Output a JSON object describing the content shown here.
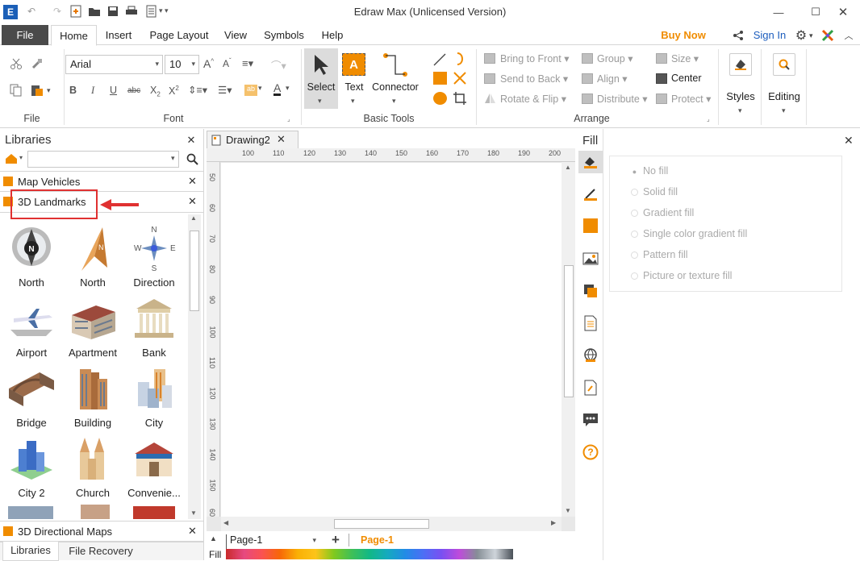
{
  "window": {
    "title": "Edraw Max (Unlicensed Version)"
  },
  "menu": {
    "tabs": [
      "File",
      "Home",
      "Insert",
      "Page Layout",
      "View",
      "Symbols",
      "Help"
    ],
    "buy_now": "Buy Now",
    "sign_in": "Sign In"
  },
  "ribbon": {
    "file_group": "File",
    "font": {
      "name": "Arial",
      "size": "10",
      "group": "Font"
    },
    "basic_tools": {
      "select": "Select",
      "text": "Text",
      "connector": "Connector",
      "group": "Basic Tools"
    },
    "arrange": {
      "bring_to_front": "Bring to Front",
      "send_to_back": "Send to Back",
      "rotate_flip": "Rotate & Flip",
      "group": "Group",
      "align": "Align",
      "distribute": "Distribute",
      "size": "Size",
      "center": "Center",
      "protect": "Protect",
      "group_label": "Arrange"
    },
    "styles": "Styles",
    "editing": "Editing"
  },
  "libraries": {
    "title": "Libraries",
    "search_placeholder": "",
    "sections": [
      "Map Vehicles",
      "3D Landmarks",
      "3D Directional Maps"
    ],
    "items": [
      {
        "label": "North",
        "icon": "north-compass-icon"
      },
      {
        "label": "North",
        "icon": "north-arrow-icon"
      },
      {
        "label": "Direction",
        "icon": "direction-icon"
      },
      {
        "label": "Airport",
        "icon": "airport-icon"
      },
      {
        "label": "Apartment",
        "icon": "apartment-icon"
      },
      {
        "label": "Bank",
        "icon": "bank-icon"
      },
      {
        "label": "Bridge",
        "icon": "bridge-icon"
      },
      {
        "label": "Building",
        "icon": "building-icon"
      },
      {
        "label": "City",
        "icon": "city-icon"
      },
      {
        "label": "City 2",
        "icon": "city-2-icon"
      },
      {
        "label": "Church",
        "icon": "church-icon"
      },
      {
        "label": "Convenie...",
        "icon": "convenience-store-icon"
      }
    ],
    "bottom_tabs": [
      "Libraries",
      "File Recovery"
    ]
  },
  "document": {
    "tab": "Drawing2",
    "ruler_h": [
      "100",
      "110",
      "120",
      "130",
      "140",
      "150",
      "160",
      "170",
      "180",
      "190",
      "200"
    ],
    "ruler_v": [
      "50",
      "60",
      "70",
      "80",
      "90",
      "100",
      "110",
      "120",
      "130",
      "140",
      "150",
      "60"
    ],
    "page_select": "Page-1",
    "active_page": "Page-1",
    "fill_label": "Fill"
  },
  "fill_panel": {
    "title": "Fill",
    "options": [
      "No fill",
      "Solid fill",
      "Gradient fill",
      "Single color gradient fill",
      "Pattern fill",
      "Picture or texture fill"
    ]
  },
  "colors": {
    "accent": "#f08c00",
    "file_tab": "#4a4a4a",
    "select_bg": "#dcdcdc",
    "highlight": "#e03131"
  }
}
